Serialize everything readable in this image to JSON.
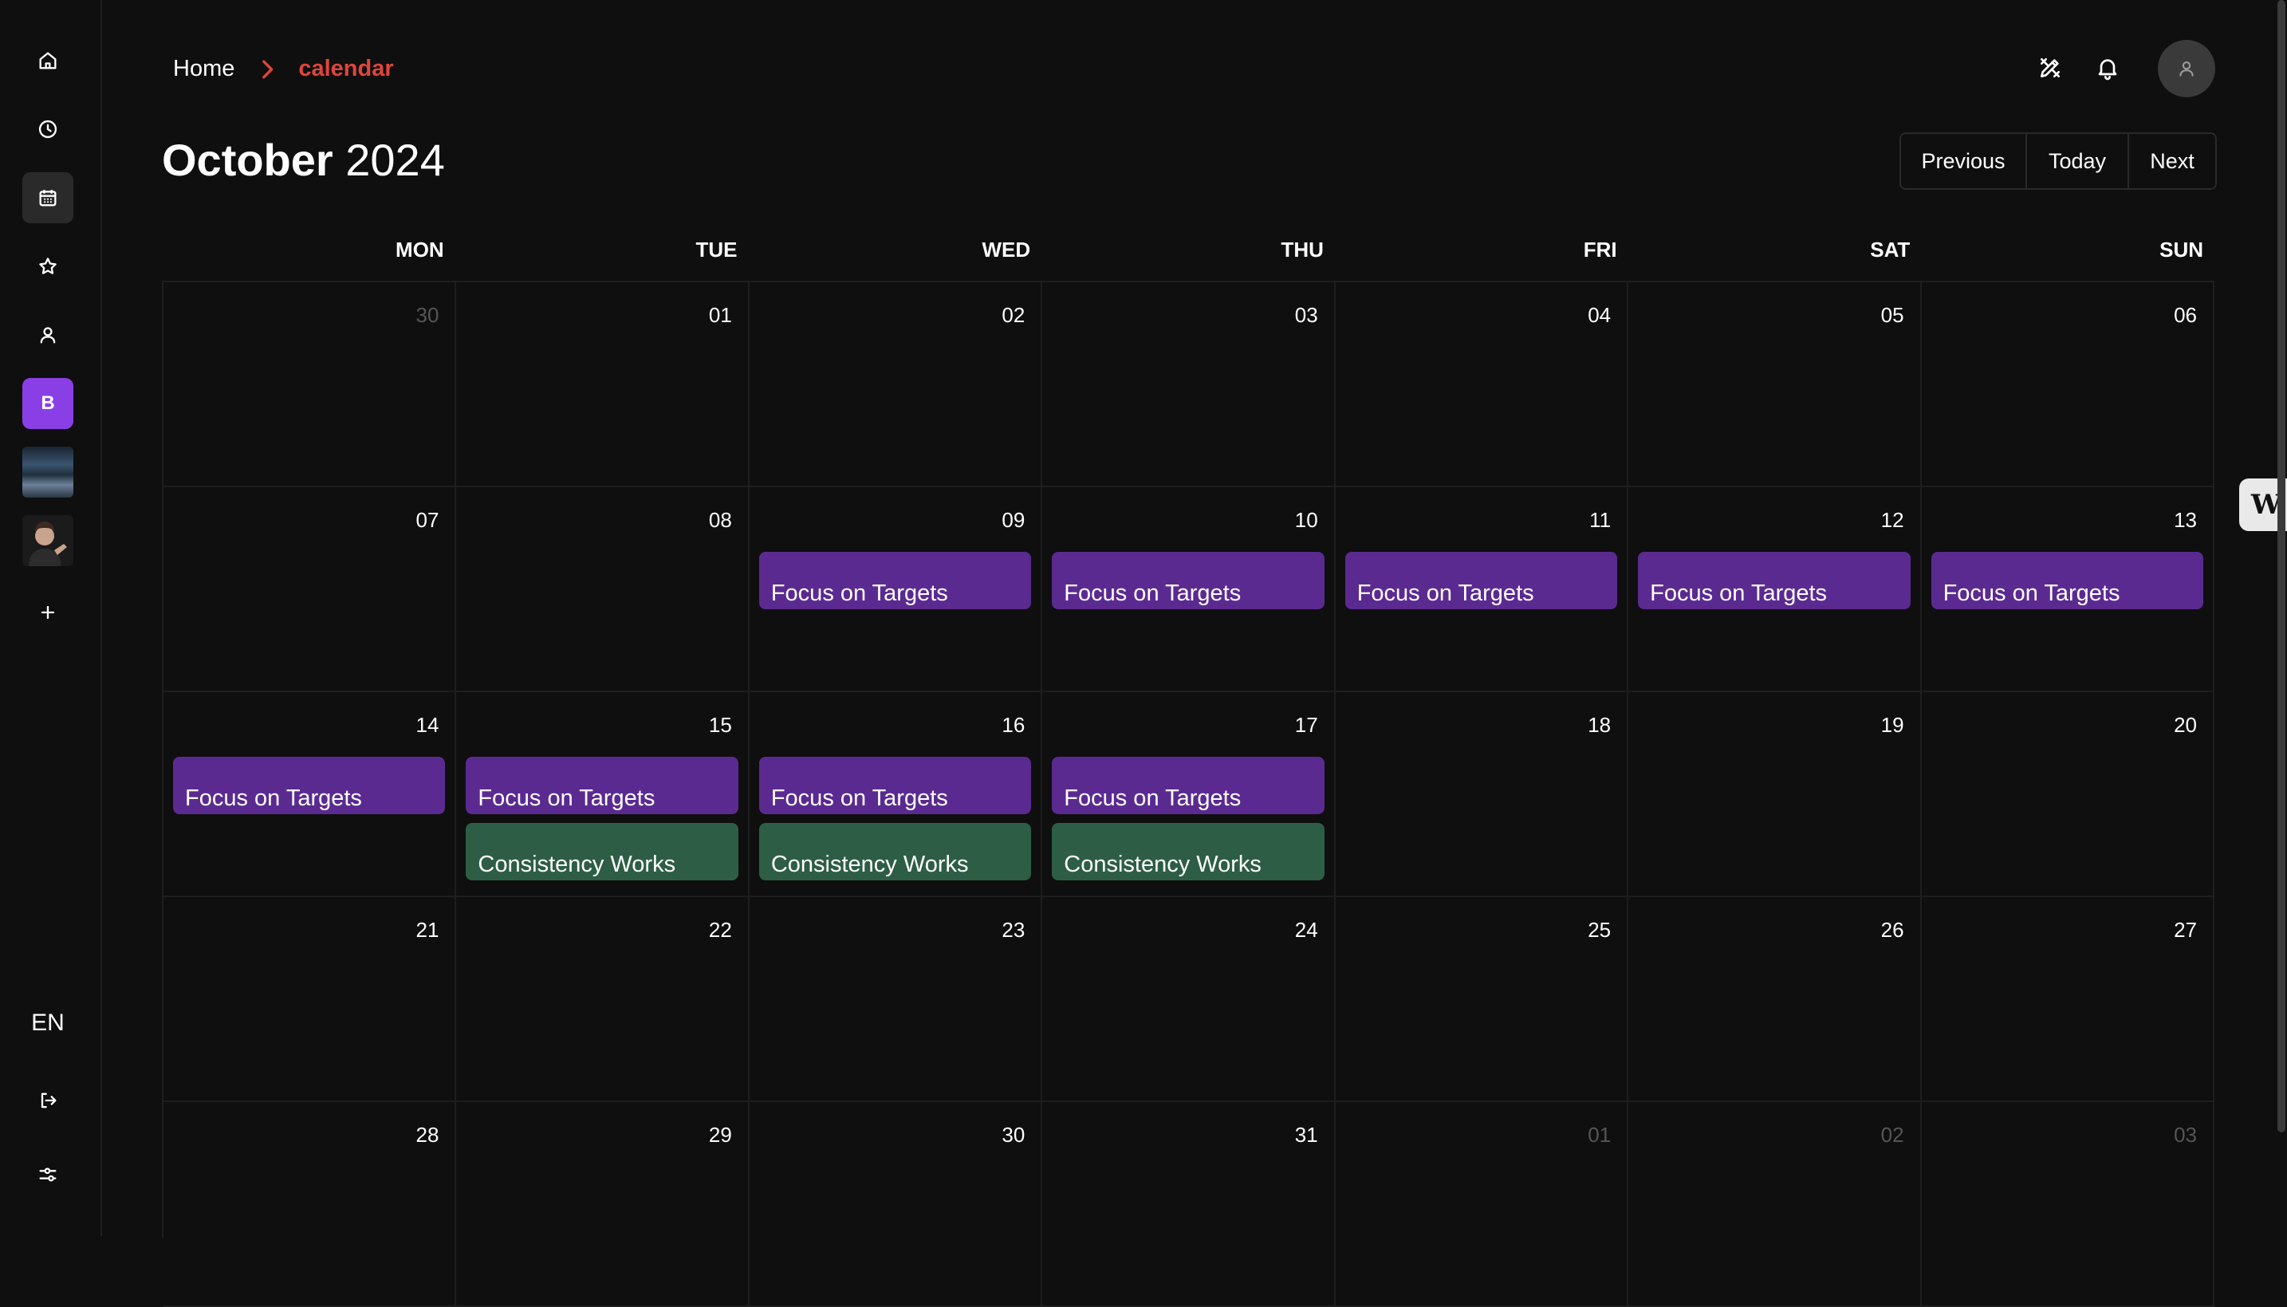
{
  "sidebar": {
    "items": [
      {
        "name": "home-icon",
        "active": false
      },
      {
        "name": "clock-icon",
        "active": false
      },
      {
        "name": "calendar-icon",
        "active": true
      },
      {
        "name": "star-icon",
        "active": false
      },
      {
        "name": "user-icon",
        "active": false
      }
    ],
    "workspace_badge": "B",
    "language": "EN",
    "bottom_icons": [
      "logout-icon",
      "settings-sliders-icon"
    ]
  },
  "header": {
    "breadcrumb_home": "Home",
    "breadcrumb_current": "calendar",
    "icons": [
      "tools-icon",
      "bell-icon"
    ]
  },
  "calendar": {
    "month": "October",
    "year": "2024",
    "nav": {
      "previous": "Previous",
      "today": "Today",
      "next": "Next"
    },
    "weekdays": [
      "MON",
      "TUE",
      "WED",
      "THU",
      "FRI",
      "SAT",
      "SUN"
    ],
    "weeks": [
      [
        {
          "day": "30",
          "other": true,
          "events": []
        },
        {
          "day": "01",
          "other": false,
          "events": []
        },
        {
          "day": "02",
          "other": false,
          "events": []
        },
        {
          "day": "03",
          "other": false,
          "events": []
        },
        {
          "day": "04",
          "other": false,
          "events": []
        },
        {
          "day": "05",
          "other": false,
          "events": []
        },
        {
          "day": "06",
          "other": false,
          "events": []
        }
      ],
      [
        {
          "day": "07",
          "other": false,
          "events": []
        },
        {
          "day": "08",
          "other": false,
          "events": []
        },
        {
          "day": "09",
          "other": false,
          "events": [
            {
              "title": "Focus on Targets",
              "color": "#5b2a91"
            }
          ]
        },
        {
          "day": "10",
          "other": false,
          "events": [
            {
              "title": "Focus on Targets",
              "color": "#5b2a91"
            }
          ]
        },
        {
          "day": "11",
          "other": false,
          "events": [
            {
              "title": "Focus on Targets",
              "color": "#5b2a91"
            }
          ]
        },
        {
          "day": "12",
          "other": false,
          "events": [
            {
              "title": "Focus on Targets",
              "color": "#5b2a91"
            }
          ]
        },
        {
          "day": "13",
          "other": false,
          "events": [
            {
              "title": "Focus on Targets",
              "color": "#5b2a91"
            }
          ]
        }
      ],
      [
        {
          "day": "14",
          "other": false,
          "events": [
            {
              "title": "Focus on Targets",
              "color": "#5b2a91"
            }
          ]
        },
        {
          "day": "15",
          "other": false,
          "events": [
            {
              "title": "Focus on Targets",
              "color": "#5b2a91"
            },
            {
              "title": "Consistency Works",
              "color": "#2d5e45"
            }
          ]
        },
        {
          "day": "16",
          "other": false,
          "events": [
            {
              "title": "Focus on Targets",
              "color": "#5b2a91"
            },
            {
              "title": "Consistency Works",
              "color": "#2d5e45"
            }
          ]
        },
        {
          "day": "17",
          "other": false,
          "events": [
            {
              "title": "Focus on Targets",
              "color": "#5b2a91"
            },
            {
              "title": "Consistency Works",
              "color": "#2d5e45"
            }
          ]
        },
        {
          "day": "18",
          "other": false,
          "events": []
        },
        {
          "day": "19",
          "other": false,
          "events": []
        },
        {
          "day": "20",
          "other": false,
          "events": []
        }
      ],
      [
        {
          "day": "21",
          "other": false,
          "events": []
        },
        {
          "day": "22",
          "other": false,
          "events": []
        },
        {
          "day": "23",
          "other": false,
          "events": []
        },
        {
          "day": "24",
          "other": false,
          "events": []
        },
        {
          "day": "25",
          "other": false,
          "events": []
        },
        {
          "day": "26",
          "other": false,
          "events": []
        },
        {
          "day": "27",
          "other": false,
          "events": []
        }
      ],
      [
        {
          "day": "28",
          "other": false,
          "events": []
        },
        {
          "day": "29",
          "other": false,
          "events": []
        },
        {
          "day": "30",
          "other": false,
          "events": []
        },
        {
          "day": "31",
          "other": false,
          "events": []
        },
        {
          "day": "01",
          "other": true,
          "events": []
        },
        {
          "day": "02",
          "other": true,
          "events": []
        },
        {
          "day": "03",
          "other": true,
          "events": []
        }
      ]
    ]
  },
  "side_tab": {
    "label": "W"
  },
  "colors": {
    "background": "#0f0f0f",
    "accent_red": "#e0453a",
    "badge_purple": "#8a3fe6",
    "event_purple": "#5b2a91",
    "event_green": "#2d5e45"
  }
}
